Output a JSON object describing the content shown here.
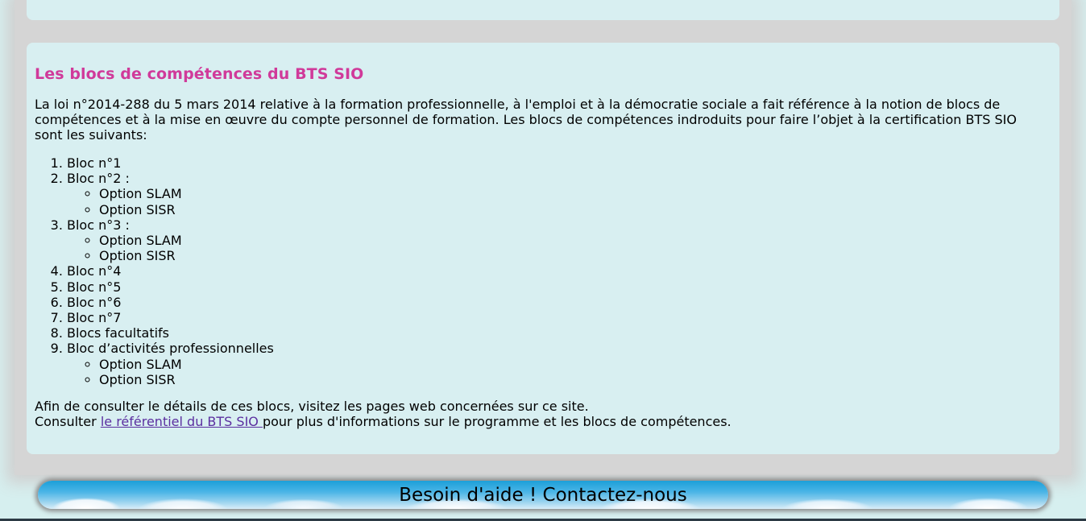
{
  "section": {
    "title": "Les blocs de compétences du BTS SIO",
    "intro": "La loi n°2014-288 du 5 mars 2014 relative à la formation professionnelle, à l'emploi et à la démocratie sociale a fait référence à la notion de blocs de compétences et à la mise en œuvre du compte personnel de formation. Les blocs de compétences indroduits pour faire l’objet à la certification BTS SIO sont les suivants:",
    "blocs": [
      {
        "label": "Bloc n°1",
        "options": []
      },
      {
        "label": "Bloc n°2 :",
        "options": [
          "Option SLAM",
          "Option SISR"
        ]
      },
      {
        "label": "Bloc n°3 :",
        "options": [
          "Option SLAM",
          "Option SISR"
        ]
      },
      {
        "label": "Bloc n°4",
        "options": []
      },
      {
        "label": "Bloc n°5",
        "options": []
      },
      {
        "label": "Bloc n°6",
        "options": []
      },
      {
        "label": "Bloc n°7",
        "options": []
      },
      {
        "label": "Blocs facultatifs",
        "options": []
      },
      {
        "label": "Bloc d’activités professionnelles",
        "options": [
          "Option SLAM",
          "Option SISR"
        ]
      }
    ],
    "outro_line1": "Afin de consulter le détails de ces blocs, visitez les pages web concernées sur ce site.",
    "outro_prefix": "Consulter ",
    "outro_link": "le référentiel du BTS SIO ",
    "outro_suffix": "pour plus d'informations sur le programme et les blocs de compétences."
  },
  "footer": {
    "banner_text": "Besoin d'aide ! Contactez-nous"
  },
  "colors": {
    "title": "#d03a9a",
    "link": "#5b2fa0",
    "panel": "#d8eff1"
  }
}
